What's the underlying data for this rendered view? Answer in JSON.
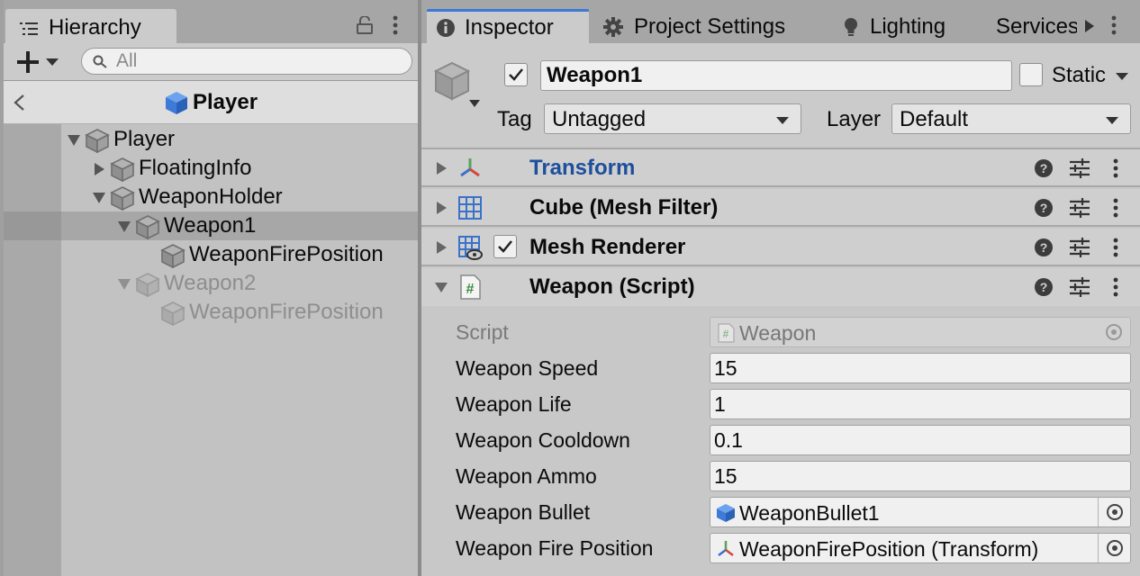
{
  "hierarchy": {
    "tab_label": "Hierarchy",
    "search_placeholder": "All",
    "header_title": "Player",
    "tree": [
      {
        "label": "Player",
        "depth": 0,
        "expanded": true,
        "selected": false,
        "disabled": false
      },
      {
        "label": "FloatingInfo",
        "depth": 1,
        "expanded": false,
        "selected": false,
        "disabled": false
      },
      {
        "label": "WeaponHolder",
        "depth": 1,
        "expanded": true,
        "selected": false,
        "disabled": false
      },
      {
        "label": "Weapon1",
        "depth": 2,
        "expanded": true,
        "selected": true,
        "disabled": false
      },
      {
        "label": "WeaponFirePosition",
        "depth": 3,
        "expanded": null,
        "selected": false,
        "disabled": false
      },
      {
        "label": "Weapon2",
        "depth": 2,
        "expanded": true,
        "selected": false,
        "disabled": true
      },
      {
        "label": "WeaponFirePosition",
        "depth": 3,
        "expanded": null,
        "selected": false,
        "disabled": true
      }
    ]
  },
  "inspector": {
    "tabs": [
      {
        "label": "Inspector",
        "icon": "info-icon",
        "active": true
      },
      {
        "label": "Project Settings",
        "icon": "gear-icon",
        "active": false
      },
      {
        "label": "Lighting",
        "icon": "lightbulb-icon",
        "active": false
      },
      {
        "label": "Services",
        "icon": "cloud-icon",
        "active": false
      }
    ],
    "object": {
      "active": true,
      "name": "Weapon1",
      "static_label": "Static",
      "static_checked": false,
      "tag_label": "Tag",
      "tag_value": "Untagged",
      "layer_label": "Layer",
      "layer_value": "Default"
    },
    "components": [
      {
        "label": "Transform",
        "icon": "transform-icon",
        "expanded": false,
        "has_checkbox": false,
        "color": "#1d4f9c"
      },
      {
        "label": "Cube (Mesh Filter)",
        "icon": "mesh-filter-icon",
        "expanded": false,
        "has_checkbox": false,
        "color": "#0a0a0a"
      },
      {
        "label": "Mesh Renderer",
        "icon": "mesh-renderer-icon",
        "expanded": false,
        "has_checkbox": true,
        "checked": true,
        "color": "#0a0a0a"
      },
      {
        "label": "Weapon (Script)",
        "icon": "script-icon",
        "expanded": true,
        "has_checkbox": false,
        "color": "#0a0a0a"
      }
    ],
    "script_props": {
      "script": {
        "label": "Script",
        "value": "Weapon"
      },
      "speed": {
        "label": "Weapon Speed",
        "value": "15"
      },
      "life": {
        "label": "Weapon Life",
        "value": "1"
      },
      "cooldown": {
        "label": "Weapon Cooldown",
        "value": "0.1"
      },
      "ammo": {
        "label": "Weapon Ammo",
        "value": "15"
      },
      "bullet": {
        "label": "Weapon Bullet",
        "value": "WeaponBullet1"
      },
      "fire_position": {
        "label": "Weapon Fire Position",
        "value": "WeaponFirePosition (Transform)"
      }
    }
  },
  "colors": {
    "accent": "#3a79d6",
    "prefab_blue": "#3d7bd6",
    "transform_label": "#1d4f9c"
  }
}
